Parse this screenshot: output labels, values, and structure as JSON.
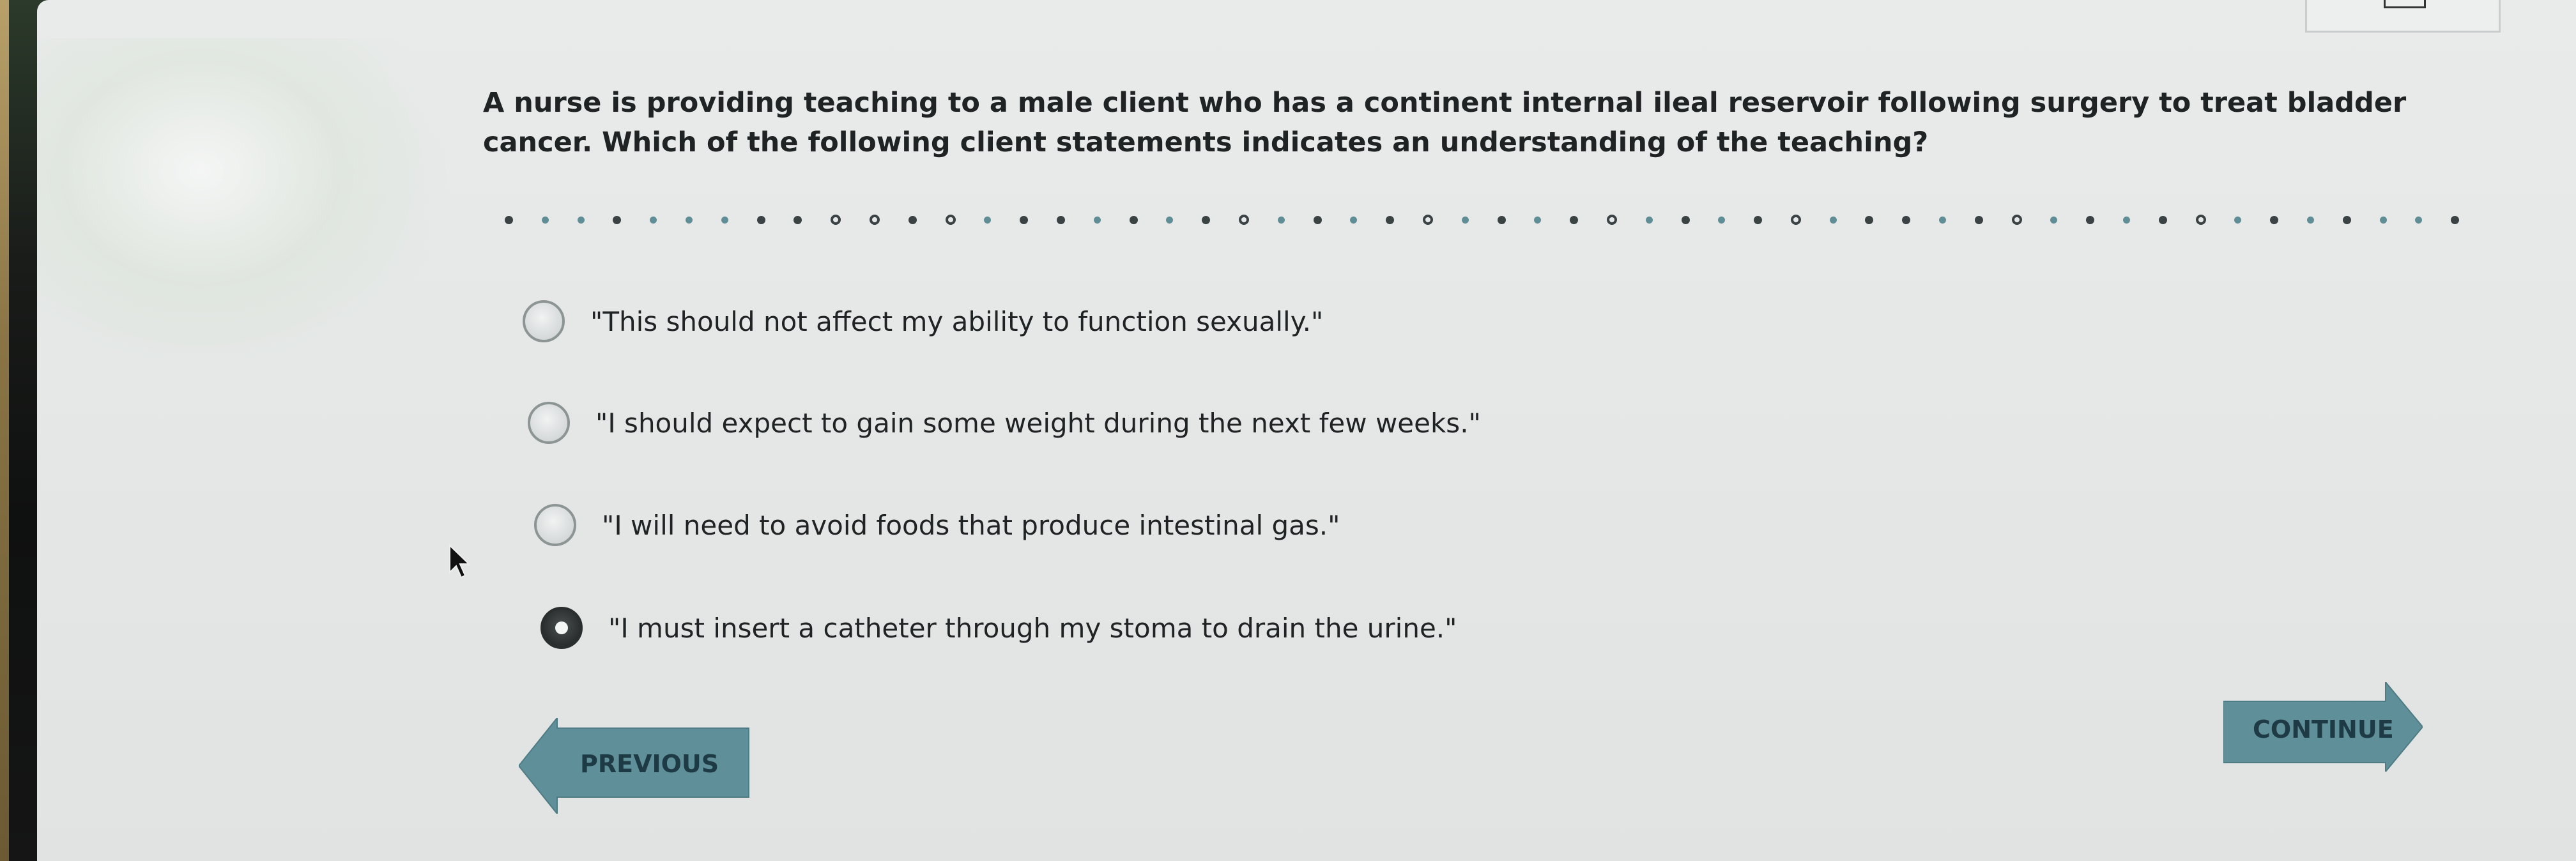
{
  "question": {
    "text": "A nurse is providing teaching to a male client who has a continent internal ileal reservoir following surgery to treat bladder cancer. Which of the following client statements indicates an understanding of the teaching?"
  },
  "options": [
    {
      "label": "\"This should not affect my ability to function sexually.\"",
      "selected": false
    },
    {
      "label": "\"I should expect to gain some weight during the next few weeks.\"",
      "selected": false
    },
    {
      "label": "\"I will need to avoid foods that produce intestinal gas.\"",
      "selected": false
    },
    {
      "label": "\"I must insert a catheter through my stoma to drain the urine.\"",
      "selected": true
    }
  ],
  "navigation": {
    "previous_label": "PREVIOUS",
    "continue_label": "CONTINUE"
  },
  "colors": {
    "accent": "#5f8f99",
    "text": "#1f2323",
    "background": "#e7e9e9"
  },
  "icons": [
    "radio-button-icon",
    "mouse-pointer-icon",
    "arrow-left-icon",
    "arrow-right-icon"
  ]
}
